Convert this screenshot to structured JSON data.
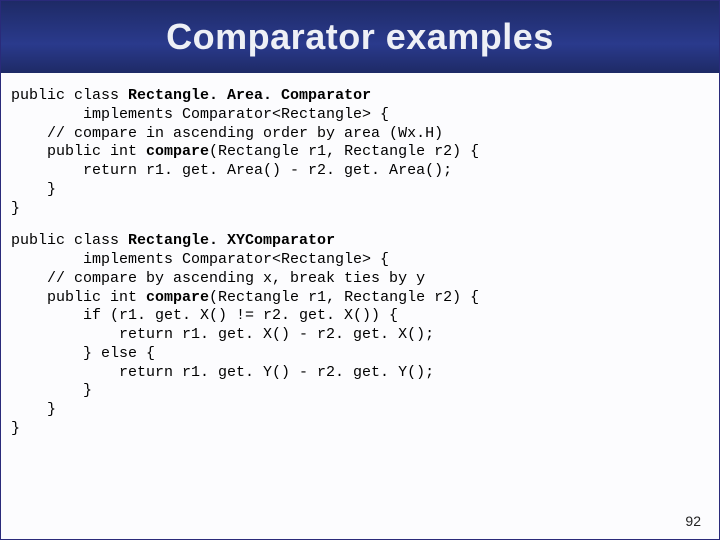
{
  "title": "Comparator examples",
  "pageNumber": "92",
  "block1": {
    "l1a": "public class ",
    "l1b": "Rectangle. Area. Comparator",
    "l2": "        implements Comparator<Rectangle> {",
    "l3": "    // compare in ascending order by area (Wx.H)",
    "l4a": "    public int ",
    "l4b": "compare",
    "l4c": "(Rectangle r1, Rectangle r2) {",
    "l5": "        return r1. get. Area() - r2. get. Area();",
    "l6": "    }",
    "l7": "}"
  },
  "block2": {
    "l1a": "public class ",
    "l1b": "Rectangle. XYComparator",
    "l2": "        implements Comparator<Rectangle> {",
    "l3": "    // compare by ascending x, break ties by y",
    "l4a": "    public int ",
    "l4b": "compare",
    "l4c": "(Rectangle r1, Rectangle r2) {",
    "l5": "        if (r1. get. X() != r2. get. X()) {",
    "l6": "            return r1. get. X() - r2. get. X();",
    "l7": "        } else {",
    "l8": "            return r1. get. Y() - r2. get. Y();",
    "l9": "        }",
    "l10": "    }",
    "l11": "}"
  }
}
